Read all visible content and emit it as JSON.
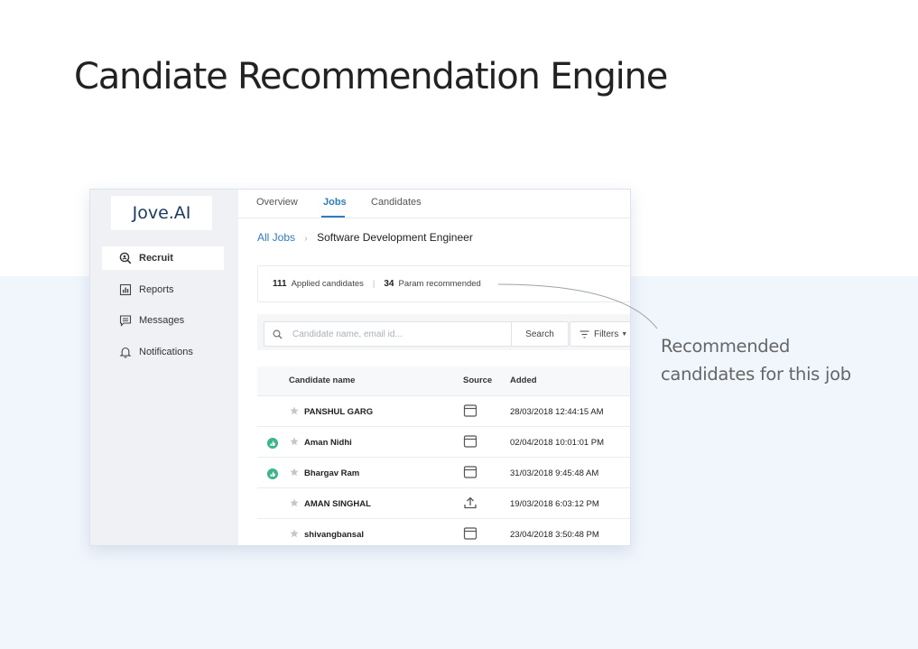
{
  "page": {
    "title": "Candiate Recommendation Engine"
  },
  "sidebar": {
    "logo": "Jove.AI",
    "items": [
      {
        "label": "Recruit",
        "icon": "search-person-icon",
        "active": true
      },
      {
        "label": "Reports",
        "icon": "bar-chart-icon"
      },
      {
        "label": "Messages",
        "icon": "message-icon"
      },
      {
        "label": "Notifications",
        "icon": "bell-icon"
      }
    ]
  },
  "tabs": [
    {
      "label": "Overview"
    },
    {
      "label": "Jobs",
      "active": true
    },
    {
      "label": "Candidates"
    }
  ],
  "breadcrumb": {
    "root": "All Jobs",
    "current": "Software Development Engineer"
  },
  "stats": {
    "applied_count": "111",
    "applied_label": "Applied candidates",
    "recommended_count": "34",
    "recommended_label": "Param recommended"
  },
  "search": {
    "placeholder": "Candidate name, email id...",
    "button": "Search",
    "filters": "Filters"
  },
  "table": {
    "headers": {
      "name": "Candidate name",
      "source": "Source",
      "added": "Added"
    },
    "rows": [
      {
        "name": "PANSHUL GARG",
        "source_icon": "browser-window-icon",
        "added": "28/03/2018 12:44:15 AM",
        "recommended": false
      },
      {
        "name": "Aman Nidhi",
        "source_icon": "browser-window-icon",
        "added": "02/04/2018 10:01:01 PM",
        "recommended": true
      },
      {
        "name": "Bhargav Ram",
        "source_icon": "browser-window-icon",
        "added": "31/03/2018 9:45:48 AM",
        "recommended": true
      },
      {
        "name": "AMAN SINGHAL",
        "source_icon": "upload-icon",
        "added": "19/03/2018 6:03:12 PM",
        "recommended": false
      },
      {
        "name": "shivangbansal",
        "source_icon": "browser-window-icon",
        "added": "23/04/2018 3:50:48 PM",
        "recommended": false
      }
    ]
  },
  "annotation": {
    "line1": "Recommended",
    "line2": "candidates for this job"
  },
  "colors": {
    "accent": "#2f7cc1",
    "recommend_badge": "#3bb58a",
    "background_tint": "#f1f6fd"
  }
}
